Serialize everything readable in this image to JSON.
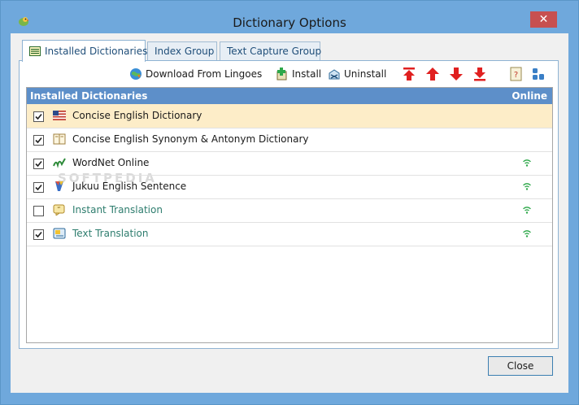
{
  "window": {
    "title": "Dictionary Options",
    "close_glyph": "✕"
  },
  "tabs": [
    {
      "label": "Installed Dictionaries",
      "active": true
    },
    {
      "label": "Index Group",
      "active": false
    },
    {
      "label": "Text Capture Group",
      "active": false
    }
  ],
  "toolbar": {
    "download_label": "Download From Lingoes",
    "install_label": "Install",
    "uninstall_label": "Uninstall"
  },
  "list": {
    "columns": [
      "Installed Dictionaries",
      "Online"
    ],
    "rows": [
      {
        "label": "Concise English Dictionary",
        "checked": true,
        "icon": "us-flag-icon",
        "online": false,
        "selected": true
      },
      {
        "label": "Concise English Synonym & Antonym Dictionary",
        "checked": true,
        "icon": "book-icon",
        "online": false,
        "selected": false
      },
      {
        "label": "WordNet Online",
        "checked": true,
        "icon": "wordnet-icon",
        "online": true,
        "selected": false
      },
      {
        "label": "Jukuu English Sentence",
        "checked": true,
        "icon": "jukuu-icon",
        "online": true,
        "selected": false
      },
      {
        "label": "Instant Translation",
        "checked": false,
        "icon": "instant-translation-icon",
        "online": true,
        "selected": false
      },
      {
        "label": "Text Translation",
        "checked": true,
        "icon": "text-translation-icon",
        "online": true,
        "selected": false
      }
    ]
  },
  "watermark": "SOFTPEDIA",
  "footer": {
    "close_label": "Close"
  },
  "colors": {
    "accent": "#6fa8dc",
    "header": "#5d8fc9",
    "selected_row": "#fdedc8",
    "arrow_red": "#e02020",
    "online_green": "#2ea84a"
  }
}
